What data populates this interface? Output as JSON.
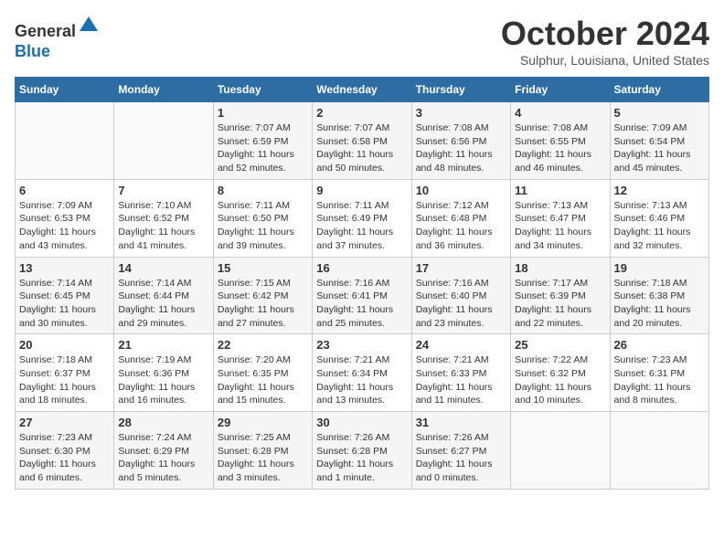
{
  "header": {
    "logo_line1": "General",
    "logo_line2": "Blue",
    "month": "October 2024",
    "location": "Sulphur, Louisiana, United States"
  },
  "days_of_week": [
    "Sunday",
    "Monday",
    "Tuesday",
    "Wednesday",
    "Thursday",
    "Friday",
    "Saturday"
  ],
  "weeks": [
    [
      {
        "day": "",
        "sunrise": "",
        "sunset": "",
        "daylight": ""
      },
      {
        "day": "",
        "sunrise": "",
        "sunset": "",
        "daylight": ""
      },
      {
        "day": "1",
        "sunrise": "Sunrise: 7:07 AM",
        "sunset": "Sunset: 6:59 PM",
        "daylight": "Daylight: 11 hours and 52 minutes."
      },
      {
        "day": "2",
        "sunrise": "Sunrise: 7:07 AM",
        "sunset": "Sunset: 6:58 PM",
        "daylight": "Daylight: 11 hours and 50 minutes."
      },
      {
        "day": "3",
        "sunrise": "Sunrise: 7:08 AM",
        "sunset": "Sunset: 6:56 PM",
        "daylight": "Daylight: 11 hours and 48 minutes."
      },
      {
        "day": "4",
        "sunrise": "Sunrise: 7:08 AM",
        "sunset": "Sunset: 6:55 PM",
        "daylight": "Daylight: 11 hours and 46 minutes."
      },
      {
        "day": "5",
        "sunrise": "Sunrise: 7:09 AM",
        "sunset": "Sunset: 6:54 PM",
        "daylight": "Daylight: 11 hours and 45 minutes."
      }
    ],
    [
      {
        "day": "6",
        "sunrise": "Sunrise: 7:09 AM",
        "sunset": "Sunset: 6:53 PM",
        "daylight": "Daylight: 11 hours and 43 minutes."
      },
      {
        "day": "7",
        "sunrise": "Sunrise: 7:10 AM",
        "sunset": "Sunset: 6:52 PM",
        "daylight": "Daylight: 11 hours and 41 minutes."
      },
      {
        "day": "8",
        "sunrise": "Sunrise: 7:11 AM",
        "sunset": "Sunset: 6:50 PM",
        "daylight": "Daylight: 11 hours and 39 minutes."
      },
      {
        "day": "9",
        "sunrise": "Sunrise: 7:11 AM",
        "sunset": "Sunset: 6:49 PM",
        "daylight": "Daylight: 11 hours and 37 minutes."
      },
      {
        "day": "10",
        "sunrise": "Sunrise: 7:12 AM",
        "sunset": "Sunset: 6:48 PM",
        "daylight": "Daylight: 11 hours and 36 minutes."
      },
      {
        "day": "11",
        "sunrise": "Sunrise: 7:13 AM",
        "sunset": "Sunset: 6:47 PM",
        "daylight": "Daylight: 11 hours and 34 minutes."
      },
      {
        "day": "12",
        "sunrise": "Sunrise: 7:13 AM",
        "sunset": "Sunset: 6:46 PM",
        "daylight": "Daylight: 11 hours and 32 minutes."
      }
    ],
    [
      {
        "day": "13",
        "sunrise": "Sunrise: 7:14 AM",
        "sunset": "Sunset: 6:45 PM",
        "daylight": "Daylight: 11 hours and 30 minutes."
      },
      {
        "day": "14",
        "sunrise": "Sunrise: 7:14 AM",
        "sunset": "Sunset: 6:44 PM",
        "daylight": "Daylight: 11 hours and 29 minutes."
      },
      {
        "day": "15",
        "sunrise": "Sunrise: 7:15 AM",
        "sunset": "Sunset: 6:42 PM",
        "daylight": "Daylight: 11 hours and 27 minutes."
      },
      {
        "day": "16",
        "sunrise": "Sunrise: 7:16 AM",
        "sunset": "Sunset: 6:41 PM",
        "daylight": "Daylight: 11 hours and 25 minutes."
      },
      {
        "day": "17",
        "sunrise": "Sunrise: 7:16 AM",
        "sunset": "Sunset: 6:40 PM",
        "daylight": "Daylight: 11 hours and 23 minutes."
      },
      {
        "day": "18",
        "sunrise": "Sunrise: 7:17 AM",
        "sunset": "Sunset: 6:39 PM",
        "daylight": "Daylight: 11 hours and 22 minutes."
      },
      {
        "day": "19",
        "sunrise": "Sunrise: 7:18 AM",
        "sunset": "Sunset: 6:38 PM",
        "daylight": "Daylight: 11 hours and 20 minutes."
      }
    ],
    [
      {
        "day": "20",
        "sunrise": "Sunrise: 7:18 AM",
        "sunset": "Sunset: 6:37 PM",
        "daylight": "Daylight: 11 hours and 18 minutes."
      },
      {
        "day": "21",
        "sunrise": "Sunrise: 7:19 AM",
        "sunset": "Sunset: 6:36 PM",
        "daylight": "Daylight: 11 hours and 16 minutes."
      },
      {
        "day": "22",
        "sunrise": "Sunrise: 7:20 AM",
        "sunset": "Sunset: 6:35 PM",
        "daylight": "Daylight: 11 hours and 15 minutes."
      },
      {
        "day": "23",
        "sunrise": "Sunrise: 7:21 AM",
        "sunset": "Sunset: 6:34 PM",
        "daylight": "Daylight: 11 hours and 13 minutes."
      },
      {
        "day": "24",
        "sunrise": "Sunrise: 7:21 AM",
        "sunset": "Sunset: 6:33 PM",
        "daylight": "Daylight: 11 hours and 11 minutes."
      },
      {
        "day": "25",
        "sunrise": "Sunrise: 7:22 AM",
        "sunset": "Sunset: 6:32 PM",
        "daylight": "Daylight: 11 hours and 10 minutes."
      },
      {
        "day": "26",
        "sunrise": "Sunrise: 7:23 AM",
        "sunset": "Sunset: 6:31 PM",
        "daylight": "Daylight: 11 hours and 8 minutes."
      }
    ],
    [
      {
        "day": "27",
        "sunrise": "Sunrise: 7:23 AM",
        "sunset": "Sunset: 6:30 PM",
        "daylight": "Daylight: 11 hours and 6 minutes."
      },
      {
        "day": "28",
        "sunrise": "Sunrise: 7:24 AM",
        "sunset": "Sunset: 6:29 PM",
        "daylight": "Daylight: 11 hours and 5 minutes."
      },
      {
        "day": "29",
        "sunrise": "Sunrise: 7:25 AM",
        "sunset": "Sunset: 6:28 PM",
        "daylight": "Daylight: 11 hours and 3 minutes."
      },
      {
        "day": "30",
        "sunrise": "Sunrise: 7:26 AM",
        "sunset": "Sunset: 6:28 PM",
        "daylight": "Daylight: 11 hours and 1 minute."
      },
      {
        "day": "31",
        "sunrise": "Sunrise: 7:26 AM",
        "sunset": "Sunset: 6:27 PM",
        "daylight": "Daylight: 11 hours and 0 minutes."
      },
      {
        "day": "",
        "sunrise": "",
        "sunset": "",
        "daylight": ""
      },
      {
        "day": "",
        "sunrise": "",
        "sunset": "",
        "daylight": ""
      }
    ]
  ]
}
